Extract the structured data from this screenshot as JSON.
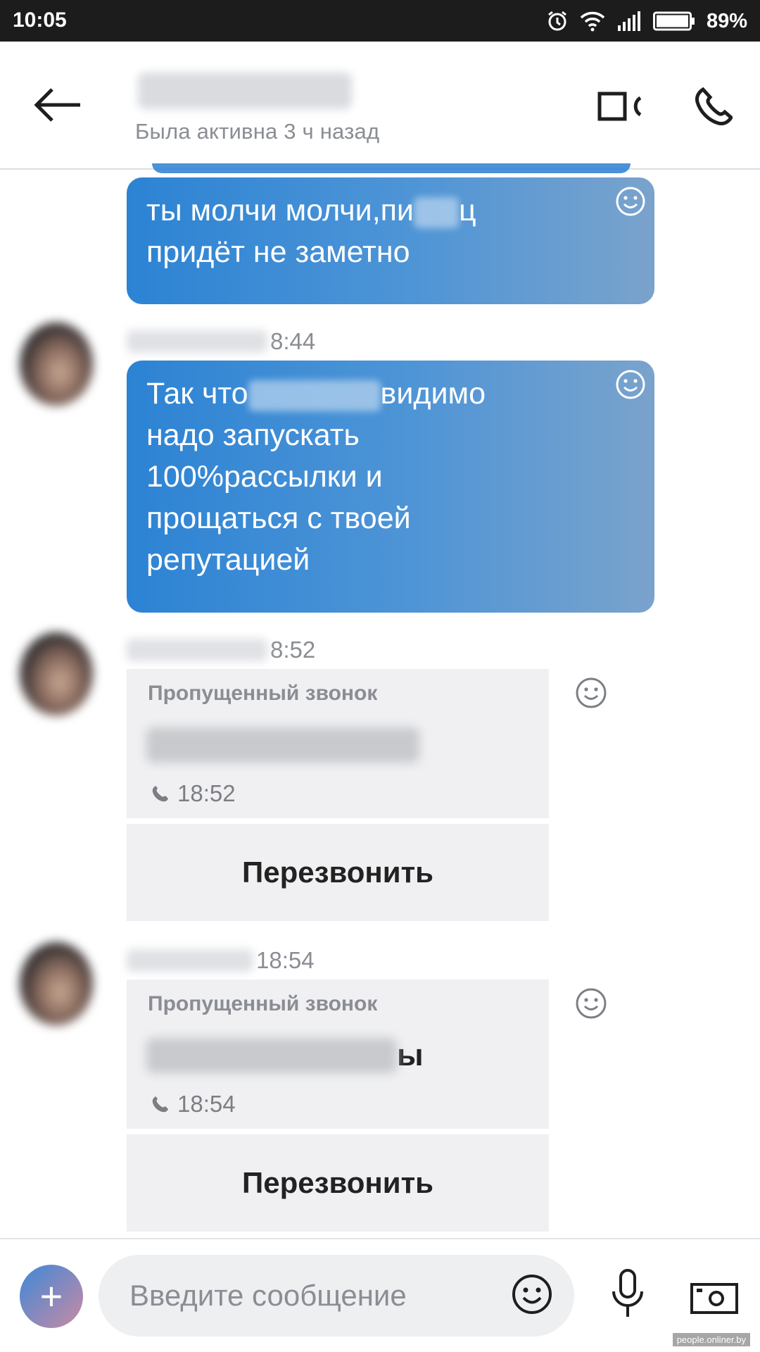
{
  "status_bar": {
    "time": "10:05",
    "battery_percent": "89%",
    "icons": [
      "alarm-icon",
      "wifi-icon",
      "signal-icon",
      "battery-icon"
    ]
  },
  "header": {
    "contact_status": "Была активна 3 ч назад",
    "icons": [
      "back-arrow-icon",
      "video-call-icon",
      "phone-icon"
    ]
  },
  "messages": [
    {
      "type": "text",
      "line1_before": "ты молчи молчи,пи",
      "line1_after": "ц",
      "line2": "придёт не заметно"
    },
    {
      "type": "text",
      "sender_time": "8:44",
      "line1_before": "Так что",
      "line1_after": "видимо",
      "line2": "надо запускать",
      "line3": "100%рассылки и",
      "line4": "прощаться с твоей",
      "line5": "репутацией"
    },
    {
      "type": "missed_call",
      "sender_time": "8:52",
      "title": "Пропущенный звонок",
      "who_suffix": "",
      "call_time": "18:52",
      "callback_label": "Перезвонить"
    },
    {
      "type": "missed_call",
      "sender_time": "18:54",
      "title": "Пропущенный звонок",
      "who_suffix": "ы",
      "call_time": "18:54",
      "callback_label": "Перезвонить"
    }
  ],
  "composer": {
    "plus_label": "+",
    "placeholder": "Введите сообщение",
    "icons": [
      "emoji-icon",
      "microphone-icon",
      "camera-icon"
    ]
  },
  "watermark": "people.onliner.by",
  "colors": {
    "bubble_start": "#2c83d4",
    "bubble_end": "#7aa3cc",
    "status_bar_bg": "#1c1c1c",
    "card_bg": "#f0f0f2"
  }
}
